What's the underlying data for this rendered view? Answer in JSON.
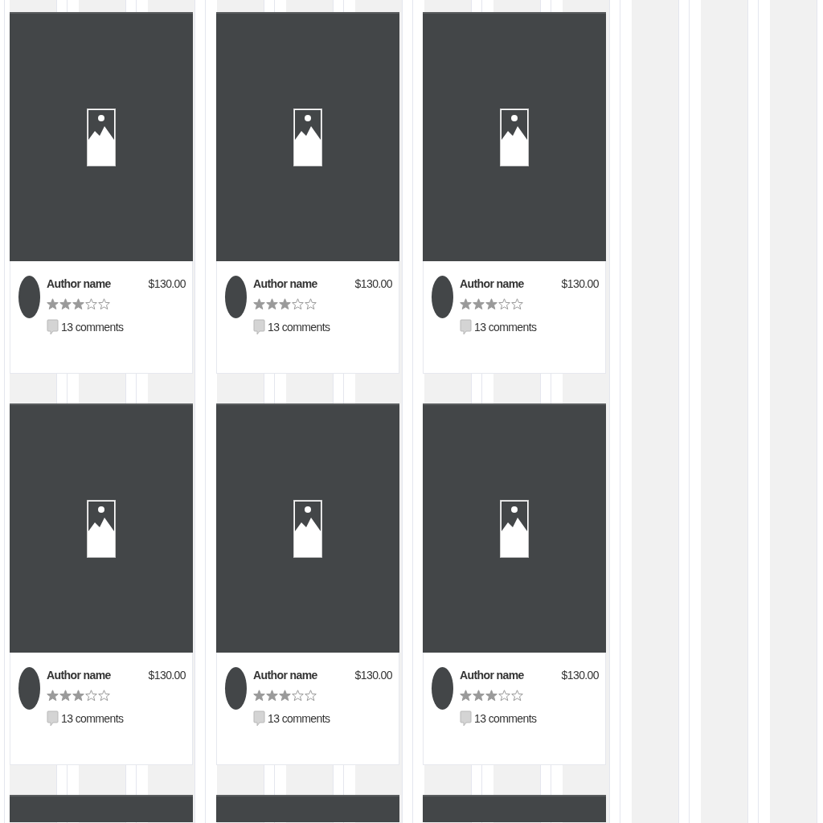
{
  "cards": [
    {
      "kind": "full",
      "author": "Author name",
      "price": "$130.00",
      "stars": 3,
      "comments": "13 comments"
    },
    {
      "kind": "full",
      "author": "Author name",
      "price": "$130.00",
      "stars": 3,
      "comments": "13 comments"
    },
    {
      "kind": "full",
      "author": "Author name",
      "price": "$130.00",
      "stars": 3,
      "comments": "13 comments"
    },
    {
      "kind": "full",
      "author": "Author name",
      "price": "$130.00",
      "stars": 3,
      "comments": "13 comments"
    },
    {
      "kind": "full",
      "author": "Author name",
      "price": "$130.00",
      "stars": 3,
      "comments": "13 comments"
    },
    {
      "kind": "full",
      "author": "Author name",
      "price": "$130.00",
      "stars": 3,
      "comments": "13 comments"
    },
    {
      "kind": "cut"
    },
    {
      "kind": "cut"
    },
    {
      "kind": "cut"
    }
  ]
}
